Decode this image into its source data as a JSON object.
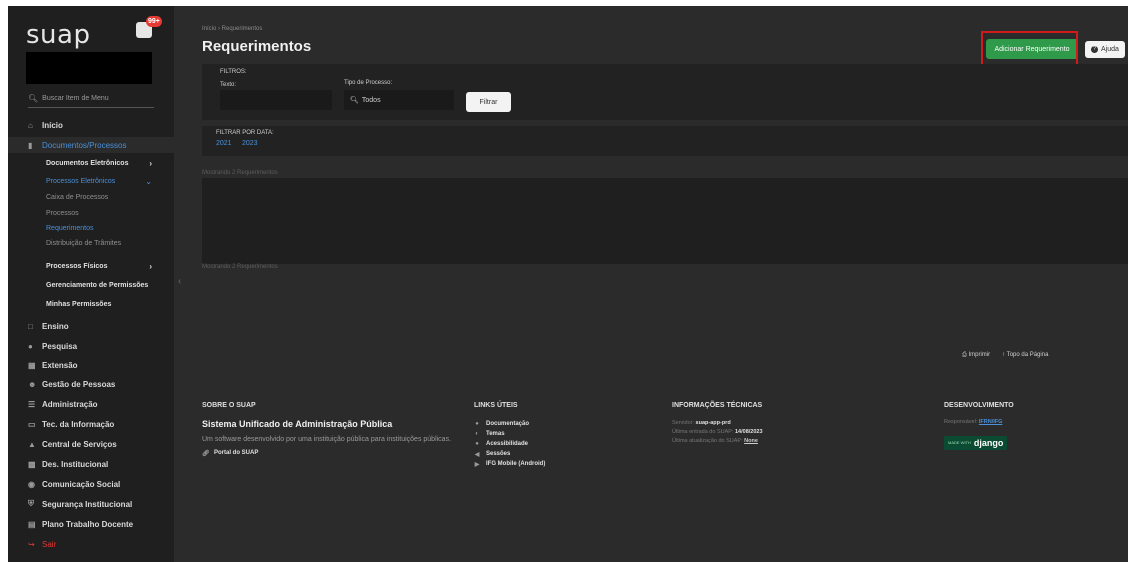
{
  "sidebar": {
    "logo": "suap",
    "notifications_badge": "99+",
    "search_placeholder": "Buscar Item de Menu",
    "items": [
      {
        "label": "Início",
        "icon": "home-icon"
      },
      {
        "label": "Documentos/Processos",
        "icon": "folder-icon"
      },
      {
        "label": "Documentos Eletrônicos"
      },
      {
        "label": "Processos Eletrônicos"
      },
      {
        "label": "Caixa de Processos"
      },
      {
        "label": "Processos"
      },
      {
        "label": "Requerimentos"
      },
      {
        "label": "Distribuição de Trâmites"
      },
      {
        "label": "Processos Físicos"
      },
      {
        "label": "Gerenciamento de Permissões"
      },
      {
        "label": "Minhas Permissões"
      },
      {
        "label": "Ensino",
        "icon": "monitor-icon"
      },
      {
        "label": "Pesquisa",
        "icon": "flask-icon"
      },
      {
        "label": "Extensão",
        "icon": "building-icon"
      },
      {
        "label": "Gestão de Pessoas",
        "icon": "users-icon"
      },
      {
        "label": "Administração",
        "icon": "list-icon"
      },
      {
        "label": "Tec. da Informação",
        "icon": "laptop-icon"
      },
      {
        "label": "Central de Serviços",
        "icon": "warning-icon"
      },
      {
        "label": "Des. Institucional",
        "icon": "chart-icon"
      },
      {
        "label": "Comunicação Social",
        "icon": "comment-icon"
      },
      {
        "label": "Segurança Institucional",
        "icon": "shield-icon"
      },
      {
        "label": "Plano Trabalho Docente",
        "icon": "id-card-icon"
      },
      {
        "label": "Sair",
        "icon": "logout-icon"
      }
    ]
  },
  "header": {
    "breadcrumb": "Início › Requerimentos",
    "title": "Requerimentos",
    "add_button": "Adicionar Requerimento",
    "help_button": "Ajuda"
  },
  "filters": {
    "section_label": "FILTROS:",
    "text_label": "Texto:",
    "text_value": "",
    "type_label": "Tipo de Processo:",
    "type_value": "Todos",
    "submit": "Filtrar"
  },
  "date_filter": {
    "label": "FILTRAR POR DATA:",
    "years": [
      "2021",
      "2023"
    ]
  },
  "results": {
    "showing_top": "Mostrando 2 Requerimentos",
    "showing_bottom": "Mostrando 2 Requerimentos"
  },
  "page_tools": {
    "print": "Imprimir",
    "top": "Topo da Página"
  },
  "footer": {
    "about": {
      "heading": "SOBRE O SUAP",
      "system_name": "Sistema Unificado de Administração Pública",
      "description": "Um software desenvolvido por uma instituição pública para instituições públicas.",
      "portal_link": "Portal do SUAP"
    },
    "links": {
      "heading": "LINKS ÚTEIS",
      "items": [
        "Documentação",
        "Temas",
        "Acessibilidade",
        "Sessões",
        "IFG Mobile (Android)"
      ]
    },
    "tech": {
      "heading": "INFORMAÇÕES TÉCNICAS",
      "server_label": "Servidor:",
      "server_value": "suap-app-prd",
      "last_entry_label": "Última entrada do SUAP:",
      "last_entry_value": "14/08/2023",
      "last_update_label": "Última atualização do SUAP:",
      "last_update_value": "None"
    },
    "dev": {
      "heading": "DESENVOLVIMENTO",
      "responsible_label": "Responsável:",
      "responsible_value": "IFRN/IFG",
      "badge_small": "MADE WITH",
      "badge_big": "django"
    }
  }
}
